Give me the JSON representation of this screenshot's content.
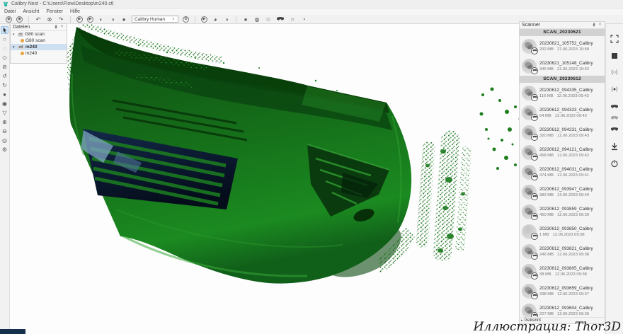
{
  "window": {
    "title": "Calibry Nest - C:\\Users\\Flow\\Desktop\\m240.ctl"
  },
  "menu": {
    "items": [
      "Datei",
      "Ansicht",
      "Fenster",
      "Hilfe"
    ]
  },
  "toolbar": {
    "icons": [
      {
        "name": "import-icon",
        "glyph": "◉"
      },
      {
        "name": "export-icon",
        "glyph": "◉"
      },
      {
        "name": "undo-icon",
        "glyph": "↶"
      },
      {
        "name": "cancel-icon",
        "glyph": "⊗"
      },
      {
        "name": "redo-icon",
        "glyph": "↷"
      },
      {
        "name": "play-forward-icon",
        "glyph": "▶"
      },
      {
        "name": "play-all-icon",
        "glyph": "▶"
      },
      {
        "name": "contrast-left-icon",
        "glyph": "◐"
      },
      {
        "name": "contrast-right-icon",
        "glyph": "◑"
      },
      {
        "name": "sphere-icon",
        "glyph": "●"
      },
      {
        "name": "device-settings-icon",
        "glyph": "⚙"
      },
      {
        "name": "process-play-icon",
        "glyph": "▶"
      },
      {
        "name": "inspect-sphere-icon",
        "glyph": "◕"
      },
      {
        "name": "half-sphere-icon",
        "glyph": "◑"
      },
      {
        "name": "shaded-sphere-icon",
        "glyph": "●"
      },
      {
        "name": "wireframe-sphere-icon",
        "glyph": "◍"
      },
      {
        "name": "disabled-icon",
        "glyph": "⊘"
      },
      {
        "name": "circle-icon",
        "glyph": "○"
      },
      {
        "name": "orbit-icon",
        "glyph": "◔"
      }
    ],
    "device_selector": {
      "value": "Calibry Human",
      "chevron": "∨"
    }
  },
  "left_toolbar": {
    "tools": [
      {
        "name": "select-tool-icon",
        "glyph": ""
      },
      {
        "name": "ellipse-select-icon",
        "glyph": "○"
      },
      {
        "name": "freeform-select-icon",
        "glyph": "◌"
      },
      {
        "name": "polygon-select-icon",
        "glyph": "◇"
      },
      {
        "name": "deselect-icon",
        "glyph": "⊘"
      },
      {
        "name": "rotate-left-icon",
        "glyph": "↺"
      },
      {
        "name": "rotate-right-icon",
        "glyph": "↻"
      },
      {
        "name": "fill-tool-icon",
        "glyph": "●"
      },
      {
        "name": "droplet-tool-icon",
        "glyph": "◉"
      },
      {
        "name": "filter-tool-icon",
        "glyph": "▽"
      },
      {
        "name": "zoom-in-icon",
        "glyph": "⊕"
      },
      {
        "name": "zoom-out-icon",
        "glyph": "⊖"
      },
      {
        "name": "focus-view-icon",
        "glyph": "◎"
      },
      {
        "name": "settings-tool-icon",
        "glyph": "⚙"
      }
    ]
  },
  "files_panel": {
    "title": "Dateien",
    "items": [
      {
        "badge": "ctl",
        "label": "G80 scan",
        "child_label": "G80 scan",
        "selected": false
      },
      {
        "badge": "ctl",
        "label": "m240",
        "child_label": "m240",
        "selected": true
      }
    ]
  },
  "scanner_panel": {
    "title": "Scanner",
    "groups": [
      {
        "header": "SCAN_20230621",
        "items": [
          {
            "name": "20230621_105752_Calibry",
            "size": "292 MB",
            "date": "21.06.2023 10:58"
          },
          {
            "name": "20230621_105148_Calibry",
            "size": "345 MB",
            "date": "21.06.2023 10:52"
          }
        ]
      },
      {
        "header": "SCAN_20230612",
        "items": [
          {
            "name": "20230612_094335_Calibry",
            "size": "116 MB",
            "date": "12.06.2023 09:43"
          },
          {
            "name": "20230612_094323_Calibry",
            "size": "64 MB",
            "date": "12.06.2023 09:43"
          },
          {
            "name": "20230612_094231_Calibry",
            "size": "320 MB",
            "date": "12.06.2023 09:43"
          },
          {
            "name": "20230612_094121_Calibry",
            "size": "458 MB",
            "date": "12.06.2023 09:42"
          },
          {
            "name": "20230612_094031_Calibry",
            "size": "474 MB",
            "date": "12.06.2023 09:41"
          },
          {
            "name": "20230612_093947_Calibry",
            "size": "383 MB",
            "date": "12.06.2023 09:40"
          },
          {
            "name": "20230612_093859_Calibry",
            "size": "450 MB",
            "date": "12.06.2023 09:39"
          },
          {
            "name": "20230612_093850_Calibry",
            "size": "1 MB",
            "date": "12.06.2023 09:38",
            "empty": true
          },
          {
            "name": "20230612_093821_Calibry",
            "size": "246 MB",
            "date": "12.06.2023 09:38"
          },
          {
            "name": "20230612_093805_Calibry",
            "size": "38 MB",
            "date": "12.06.2023 09:38"
          },
          {
            "name": "20230612_093659_Calibry",
            "size": "298 MB",
            "date": "12.06.2023 09:37"
          },
          {
            "name": "20230612_093604_Calibry",
            "size": "227 MB",
            "date": "12.06.2023 09:36"
          }
        ]
      }
    ],
    "status_expander": "▸",
    "status": "Getrennt",
    "record_outline_label": "(○)",
    "record_filled_label": "(●)"
  },
  "watermark": {
    "text": "Иллюстрация: Thor3D"
  },
  "colors": {
    "accent_teal": "#1db39c",
    "model_green": "#15771a",
    "model_dark_green": "#0a3f0d",
    "grille_navy": "#0e2440",
    "selection_blue": "#cfe0f2",
    "group_header_bg": "#d2d2d2"
  }
}
